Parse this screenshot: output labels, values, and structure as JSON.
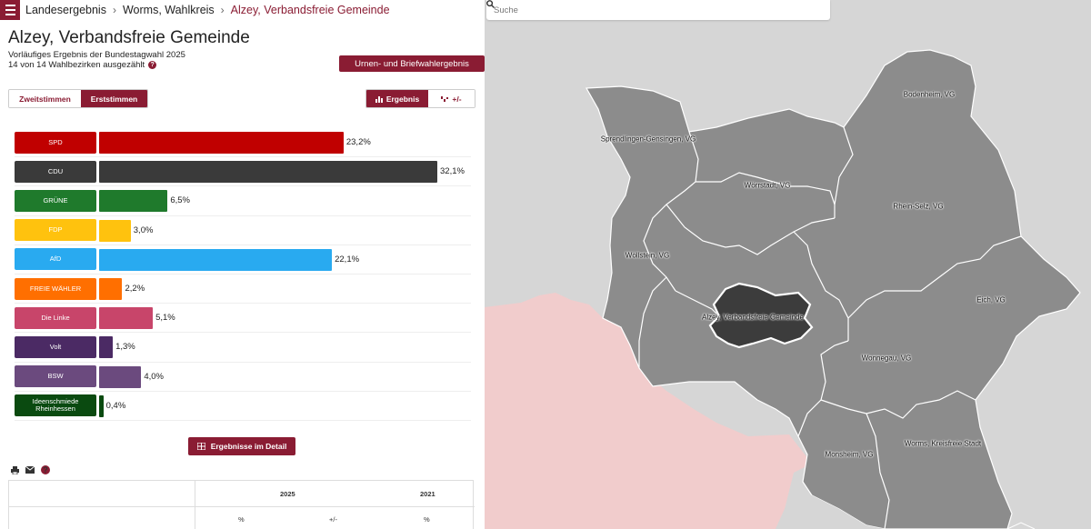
{
  "breadcrumb": {
    "items": [
      "Landesergebnis",
      "Worms, Wahlkreis"
    ],
    "current": "Alzey, Verbandsfreie Gemeinde",
    "separator": "›"
  },
  "header": {
    "title": "Alzey, Verbandsfreie Gemeinde",
    "subtitle": "Vorläufiges Ergebnis der Bundestagwahl 2025",
    "counted": "14 von 14 Wahlbezirken ausgezählt",
    "urnen_button": "Urnen- und Briefwahlergebnis"
  },
  "vote_toggle": {
    "zweit": "Zweitstimmen",
    "erst": "Erststimmen"
  },
  "view_toggle": {
    "ergebnis": "Ergebnis",
    "diff": "+/-"
  },
  "results": [
    {
      "party": "SPD",
      "value": 23.2,
      "label": "23,2%",
      "color": "#c00000"
    },
    {
      "party": "CDU",
      "value": 32.1,
      "label": "32,1%",
      "color": "#3a3a3a"
    },
    {
      "party": "GRÜNE",
      "value": 6.5,
      "label": "6,5%",
      "color": "#1f7a2c"
    },
    {
      "party": "FDP",
      "value": 3.0,
      "label": "3,0%",
      "color": "#ffc20e"
    },
    {
      "party": "AfD",
      "value": 22.1,
      "label": "22,1%",
      "color": "#29aaf0"
    },
    {
      "party": "FREIE WÄHLER",
      "value": 2.2,
      "label": "2,2%",
      "color": "#ff6f00"
    },
    {
      "party": "Die Linke",
      "value": 5.1,
      "label": "5,1%",
      "color": "#c8456a"
    },
    {
      "party": "Volt",
      "value": 1.3,
      "label": "1,3%",
      "color": "#4b2a64"
    },
    {
      "party": "BSW",
      "value": 4.0,
      "label": "4,0%",
      "color": "#6b4a7e"
    },
    {
      "party": "Ideenschmiede Rheinhessen",
      "value": 0.4,
      "label": "0,4%",
      "color": "#0a4a10"
    }
  ],
  "scale_max": 32.1,
  "detail_button": "Ergebnisse im Detail",
  "table": {
    "col_2025": "2025",
    "col_2021": "2021",
    "sub_pct": "%",
    "sub_diff": "+/-",
    "sub_pct2": "%"
  },
  "search": {
    "placeholder": "Suche"
  },
  "map_labels": [
    "Sprendlingen-Gensingen, VG",
    "Bodenheim, VG",
    "Wörrstadt, VG",
    "Rhein-Selz, VG",
    "Wöllstein, VG",
    "Eich, VG",
    "Alzey, Verbandsfreie Gemeinde",
    "Wonnegau, VG",
    "Monsheim, VG",
    "Worms, Kreisfreie Stadt"
  ],
  "map_colors": {
    "region": "#8c8c8c",
    "selected": "#3c3c3c",
    "outside": "#d6d6d6",
    "other_state": "#f1cccc",
    "border": "#ffffff"
  }
}
